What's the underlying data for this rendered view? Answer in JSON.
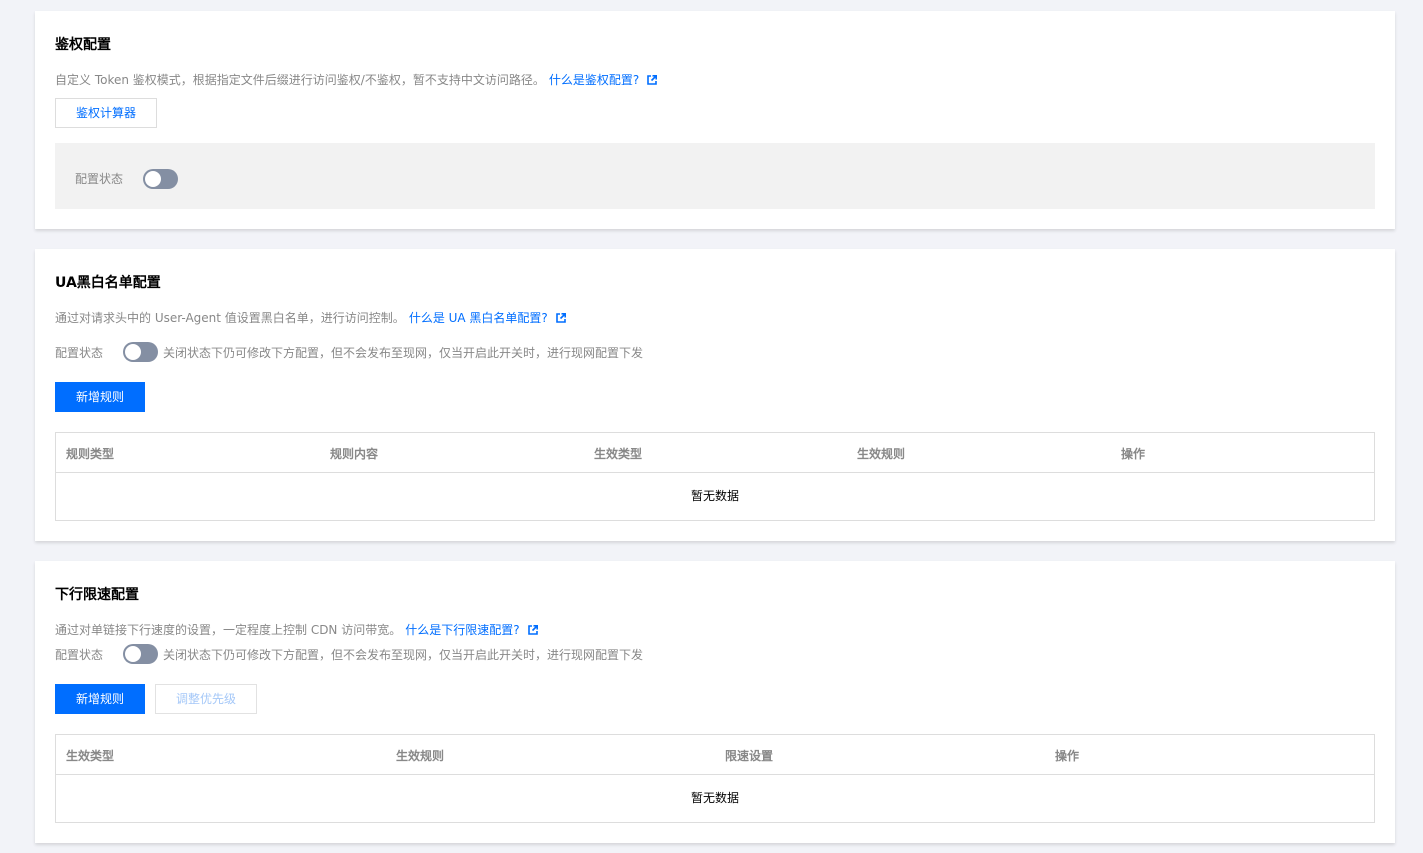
{
  "auth": {
    "title": "鉴权配置",
    "desc": "自定义 Token 鉴权模式，根据指定文件后缀进行访问鉴权/不鉴权，暂不支持中文访问路径。",
    "link": "什么是鉴权配置?",
    "calc_button": "鉴权计算器",
    "status_label": "配置状态"
  },
  "ua": {
    "title": "UA黑白名单配置",
    "desc": "通过对请求头中的 User-Agent 值设置黑白名单，进行访问控制。",
    "link": "什么是 UA 黑白名单配置?",
    "status_label": "配置状态",
    "toggle_note": "关闭状态下仍可修改下方配置，但不会发布至现网，仅当开启此开关时，进行现网配置下发",
    "add_button": "新增规则",
    "columns": [
      "规则类型",
      "规则内容",
      "生效类型",
      "生效规则",
      "操作"
    ],
    "empty": "暂无数据"
  },
  "speed": {
    "title": "下行限速配置",
    "desc": "通过对单链接下行速度的设置，一定程度上控制 CDN 访问带宽。",
    "link": "什么是下行限速配置?",
    "status_label": "配置状态",
    "toggle_note": "关闭状态下仍可修改下方配置，但不会发布至现网，仅当开启此开关时，进行现网配置下发",
    "add_button": "新增规则",
    "priority_button": "调整优先级",
    "columns": [
      "生效类型",
      "生效规则",
      "限速设置",
      "操作"
    ],
    "empty": "暂无数据"
  },
  "colors": {
    "primary": "#006eff",
    "toggle_off": "#848fa3",
    "page_bg": "#f2f3f8"
  },
  "icons": {
    "external_link": "external-link-icon"
  }
}
